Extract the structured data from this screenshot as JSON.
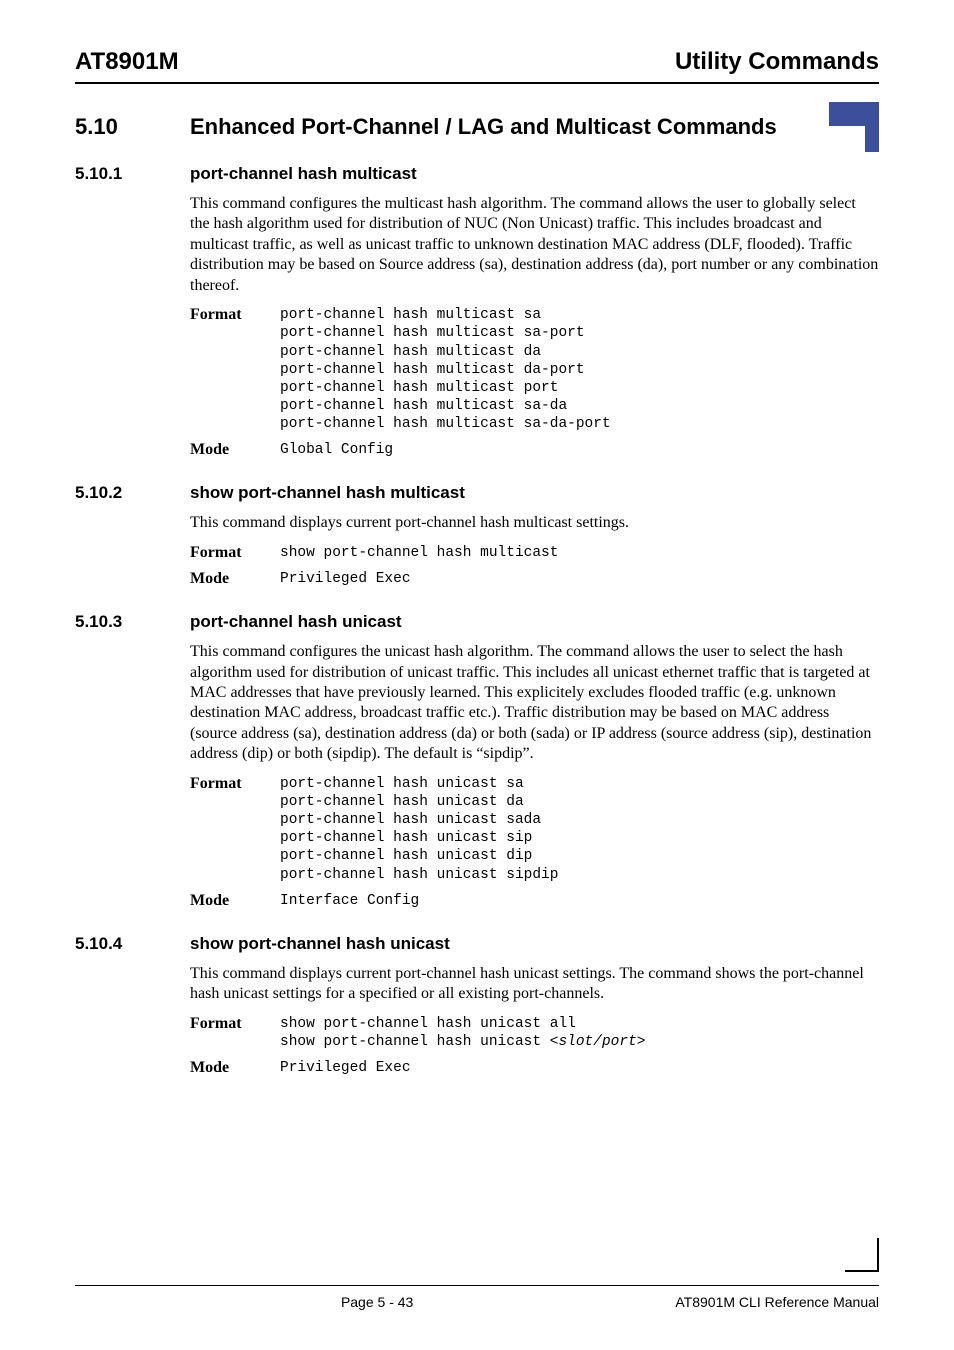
{
  "header": {
    "left": "AT8901M",
    "right": "Utility Commands"
  },
  "section": {
    "num": "5.10",
    "title": "Enhanced Port-Channel / LAG  and Multicast Commands"
  },
  "subsections": [
    {
      "num": "5.10.1",
      "title": "port-channel hash multicast",
      "para": "This command configures the multicast hash algorithm. The command allows the user to globally select the hash algorithm used for distribution of NUC (Non Unicast) traffic. This includes broadcast and multicast traffic, as well as unicast traffic to unknown destination MAC address (DLF, flooded). Traffic distribution may be based on Source address (sa), destination address (da), port number or any combination thereof.",
      "format": "port-channel hash multicast sa\nport-channel hash multicast sa-port\nport-channel hash multicast da\nport-channel hash multicast da-port\nport-channel hash multicast port\nport-channel hash multicast sa-da\nport-channel hash multicast sa-da-port",
      "mode": "Global Config"
    },
    {
      "num": "5.10.2",
      "title": "show port-channel hash multicast",
      "para": "This command displays current port-channel hash multicast settings.",
      "format": "show port-channel hash multicast",
      "mode": "Privileged Exec"
    },
    {
      "num": "5.10.3",
      "title": "port-channel hash unicast",
      "para": "This command configures the unicast hash algorithm. The command allows the user to select the hash algorithm used for distribution of unicast traffic. This includes all unicast ethernet traffic that is targeted at MAC addresses that have previously learned. This explicitely excludes flooded traffic (e.g. unknown destination MAC address, broadcast traffic etc.). Traffic distribution may be based on MAC address (source address (sa), destination address (da) or both (sada) or IP address (source address (sip), destination address (dip) or both (sipdip). The default is “sipdip”.",
      "format": "port-channel hash unicast sa\nport-channel hash unicast da\nport-channel hash unicast sada\nport-channel hash unicast sip\nport-channel hash unicast dip\nport-channel hash unicast sipdip",
      "mode": "Interface Config"
    },
    {
      "num": "5.10.4",
      "title": "show port-channel hash unicast",
      "para": "This command displays current port-channel hash unicast settings. The command shows the port-channel hash unicast settings for a specified or all existing port-channels.",
      "format_pre": "show port-channel hash unicast all\nshow port-channel hash unicast ",
      "format_ital": "<slot/port>",
      "mode": "Privileged Exec"
    }
  ],
  "labels": {
    "format": "Format",
    "mode": "Mode"
  },
  "footer": {
    "center": "Page 5 - 43",
    "right": "AT8901M CLI Reference Manual"
  }
}
